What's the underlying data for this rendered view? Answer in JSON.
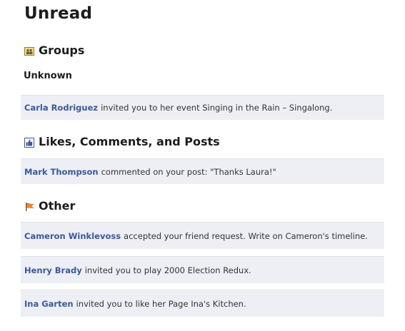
{
  "title": "Unread",
  "sections": {
    "groups": {
      "heading": "Groups",
      "icon": "groups-icon",
      "subheading": "Unknown",
      "items": [
        {
          "actor": "Carla Rodriguez",
          "text": "invited you to her event Singing in the Rain – Singalong."
        }
      ]
    },
    "likes": {
      "heading": "Likes, Comments, and Posts",
      "icon": "like-icon",
      "items": [
        {
          "actor": "Mark Thompson",
          "text": "commented on your post: \"Thanks Laura!\""
        }
      ]
    },
    "other": {
      "heading": "Other",
      "icon": "flag-icon",
      "items": [
        {
          "actor": "Cameron Winklevoss",
          "text": "accepted your friend request. Write on Cameron's timeline."
        },
        {
          "actor": "Henry Brady",
          "text": "invited you to play 2000 Election Redux."
        },
        {
          "actor": "Ina Garten",
          "text": "invited you to like her Page Ina's Kitchen."
        }
      ]
    }
  },
  "colors": {
    "link": "#3b5998",
    "row_background": "#edeff4"
  }
}
